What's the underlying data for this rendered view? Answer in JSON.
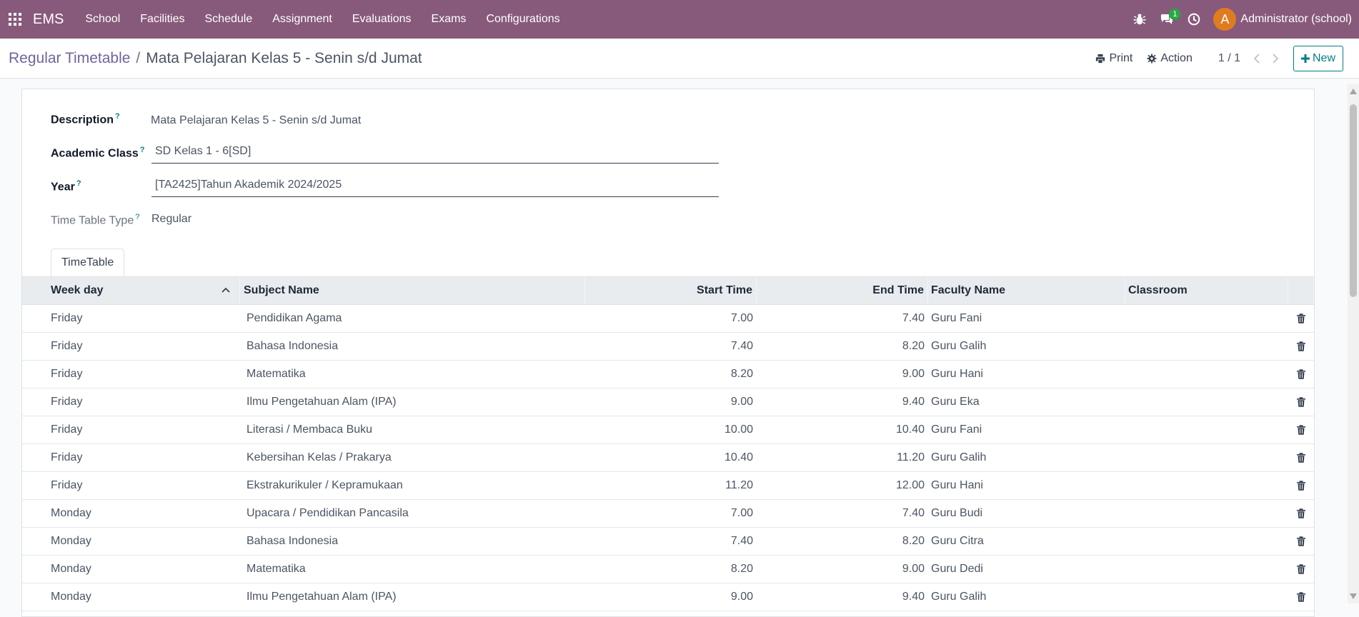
{
  "navbar": {
    "brand": "EMS",
    "menu": [
      "School",
      "Facilities",
      "Schedule",
      "Assignment",
      "Evaluations",
      "Exams",
      "Configurations"
    ],
    "messages_count": "1",
    "user_initial": "A",
    "user_name": "Administrator (school)"
  },
  "breadcrumb": {
    "parent": "Regular Timetable",
    "separator": "/",
    "current": "Mata Pelajaran Kelas 5 - Senin s/d Jumat"
  },
  "control": {
    "print_label": "Print",
    "action_label": "Action",
    "pager": "1 / 1",
    "new_label": "New"
  },
  "form": {
    "description_label": "Description",
    "description_value": "Mata Pelajaran Kelas 5 - Senin s/d Jumat",
    "academic_class_label": "Academic Class",
    "academic_class_value": "SD Kelas 1 - 6[SD]",
    "year_label": "Year",
    "year_value": "[TA2425]Tahun Akademik 2024/2025",
    "timetable_type_label": "Time Table Type",
    "timetable_type_value": "Regular",
    "help_mark": "?"
  },
  "tabs": [
    "TimeTable"
  ],
  "table": {
    "headers": {
      "week_day": "Week day",
      "subject": "Subject Name",
      "start": "Start Time",
      "end": "End Time",
      "faculty": "Faculty Name",
      "classroom": "Classroom"
    },
    "rows": [
      {
        "day": "Friday",
        "subject": "Pendidikan Agama",
        "start": "7.00",
        "end": "7.40",
        "faculty": "Guru Fani",
        "classroom": ""
      },
      {
        "day": "Friday",
        "subject": "Bahasa Indonesia",
        "start": "7.40",
        "end": "8.20",
        "faculty": "Guru Galih",
        "classroom": ""
      },
      {
        "day": "Friday",
        "subject": "Matematika",
        "start": "8.20",
        "end": "9.00",
        "faculty": "Guru Hani",
        "classroom": ""
      },
      {
        "day": "Friday",
        "subject": "Ilmu Pengetahuan Alam (IPA)",
        "start": "9.00",
        "end": "9.40",
        "faculty": "Guru Eka",
        "classroom": ""
      },
      {
        "day": "Friday",
        "subject": "Literasi / Membaca Buku",
        "start": "10.00",
        "end": "10.40",
        "faculty": "Guru Fani",
        "classroom": ""
      },
      {
        "day": "Friday",
        "subject": "Kebersihan Kelas / Prakarya",
        "start": "10.40",
        "end": "11.20",
        "faculty": "Guru Galih",
        "classroom": ""
      },
      {
        "day": "Friday",
        "subject": "Ekstrakurikuler / Kepramukaan",
        "start": "11.20",
        "end": "12.00",
        "faculty": "Guru Hani",
        "classroom": ""
      },
      {
        "day": "Monday",
        "subject": "Upacara / Pendidikan Pancasila",
        "start": "7.00",
        "end": "7.40",
        "faculty": "Guru Budi",
        "classroom": ""
      },
      {
        "day": "Monday",
        "subject": "Bahasa Indonesia",
        "start": "7.40",
        "end": "8.20",
        "faculty": "Guru Citra",
        "classroom": ""
      },
      {
        "day": "Monday",
        "subject": "Matematika",
        "start": "8.20",
        "end": "9.00",
        "faculty": "Guru Dedi",
        "classroom": ""
      },
      {
        "day": "Monday",
        "subject": "Ilmu Pengetahuan Alam (IPA)",
        "start": "9.00",
        "end": "9.40",
        "faculty": "Guru Galih",
        "classroom": ""
      }
    ]
  },
  "colors": {
    "navbar": "#875a7b",
    "accent": "#017e84",
    "link": "#71639e",
    "badge": "#28a745",
    "avatar": "#e07b1f"
  }
}
